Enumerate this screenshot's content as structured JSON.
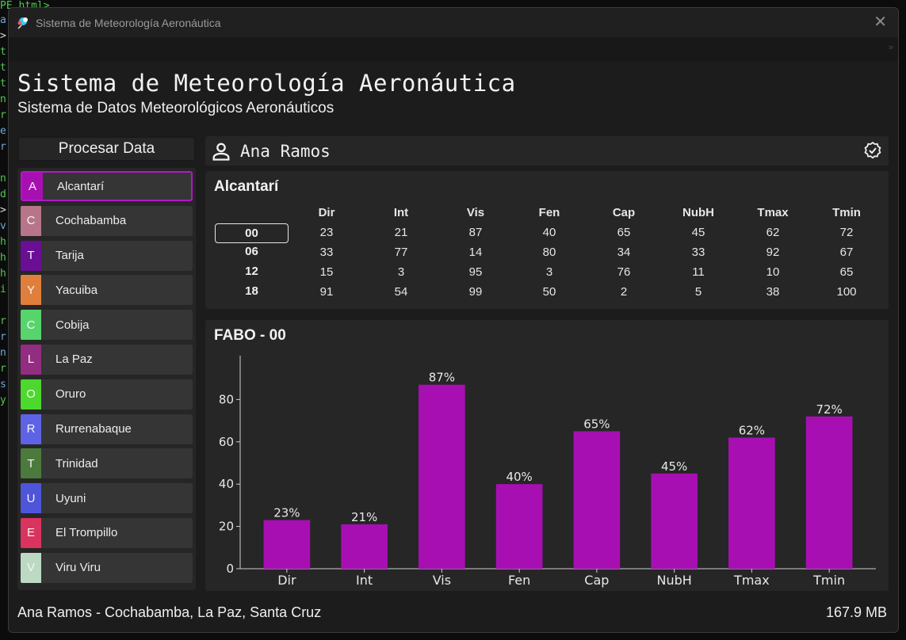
{
  "window": {
    "title": "Sistema de Meteorología Aeronáutica",
    "close_glyph": "✕"
  },
  "header": {
    "title": "Sistema de Meteorología Aeronáutica",
    "subtitle": "Sistema de Datos Meteorológicos Aeronáuticos"
  },
  "sidebar": {
    "process_label": "Procesar Data",
    "stations": [
      {
        "letter": "A",
        "name": "Alcantarí",
        "color": "#a70fb3",
        "active": true
      },
      {
        "letter": "C",
        "name": "Cochabamba",
        "color": "#b7758a",
        "active": false
      },
      {
        "letter": "T",
        "name": "Tarija",
        "color": "#6a0e96",
        "active": false
      },
      {
        "letter": "Y",
        "name": "Yacuiba",
        "color": "#e07f3b",
        "active": false
      },
      {
        "letter": "C",
        "name": "Cobija",
        "color": "#57d56c",
        "active": false
      },
      {
        "letter": "L",
        "name": "La Paz",
        "color": "#922d81",
        "active": false
      },
      {
        "letter": "O",
        "name": "Oruro",
        "color": "#4cd82d",
        "active": false
      },
      {
        "letter": "R",
        "name": "Rurrenabaque",
        "color": "#5d63e4",
        "active": false
      },
      {
        "letter": "T",
        "name": "Trinidad",
        "color": "#4c7a3d",
        "active": false
      },
      {
        "letter": "U",
        "name": "Uyuni",
        "color": "#4e55d9",
        "active": false
      },
      {
        "letter": "E",
        "name": "El Trompillo",
        "color": "#d9335f",
        "active": false
      },
      {
        "letter": "V",
        "name": "Viru Viru",
        "color": "#bcd9c3",
        "active": false
      }
    ]
  },
  "user": {
    "name": "Ana Ramos",
    "icon": "user-icon",
    "status_icon": "verified-badge-icon"
  },
  "table": {
    "title": "Alcantarí",
    "columns": [
      "Dir",
      "Int",
      "Vis",
      "Fen",
      "Cap",
      "NubH",
      "Tmax",
      "Tmin"
    ],
    "rows": [
      {
        "hour": "00",
        "selected": true,
        "values": [
          "23",
          "21",
          "87",
          "40",
          "65",
          "45",
          "62",
          "72"
        ]
      },
      {
        "hour": "06",
        "selected": false,
        "values": [
          "33",
          "77",
          "14",
          "80",
          "34",
          "33",
          "92",
          "67"
        ]
      },
      {
        "hour": "12",
        "selected": false,
        "values": [
          "15",
          "3",
          "95",
          "3",
          "76",
          "11",
          "10",
          "65"
        ]
      },
      {
        "hour": "18",
        "selected": false,
        "values": [
          "91",
          "54",
          "99",
          "50",
          "2",
          "5",
          "38",
          "100"
        ]
      }
    ]
  },
  "chart_title": "FABO - 00",
  "chart_data": {
    "type": "bar",
    "title": "FABO - 00",
    "categories": [
      "Dir",
      "Int",
      "Vis",
      "Fen",
      "Cap",
      "NubH",
      "Tmax",
      "Tmin"
    ],
    "values": [
      23,
      21,
      87,
      40,
      65,
      45,
      62,
      72
    ],
    "value_labels": [
      "23%",
      "21%",
      "87%",
      "40%",
      "65%",
      "45%",
      "62%",
      "72%"
    ],
    "yticks": [
      "0",
      "20",
      "40",
      "60",
      "80"
    ],
    "ylim": [
      0,
      97
    ],
    "bar_color": "#a70fb3",
    "grid": false,
    "xlabel": "",
    "ylabel": ""
  },
  "footer": {
    "user_regions": "Ana Ramos - Cochabamba, La Paz, Santa Cruz",
    "memory": "167.9 MB"
  }
}
